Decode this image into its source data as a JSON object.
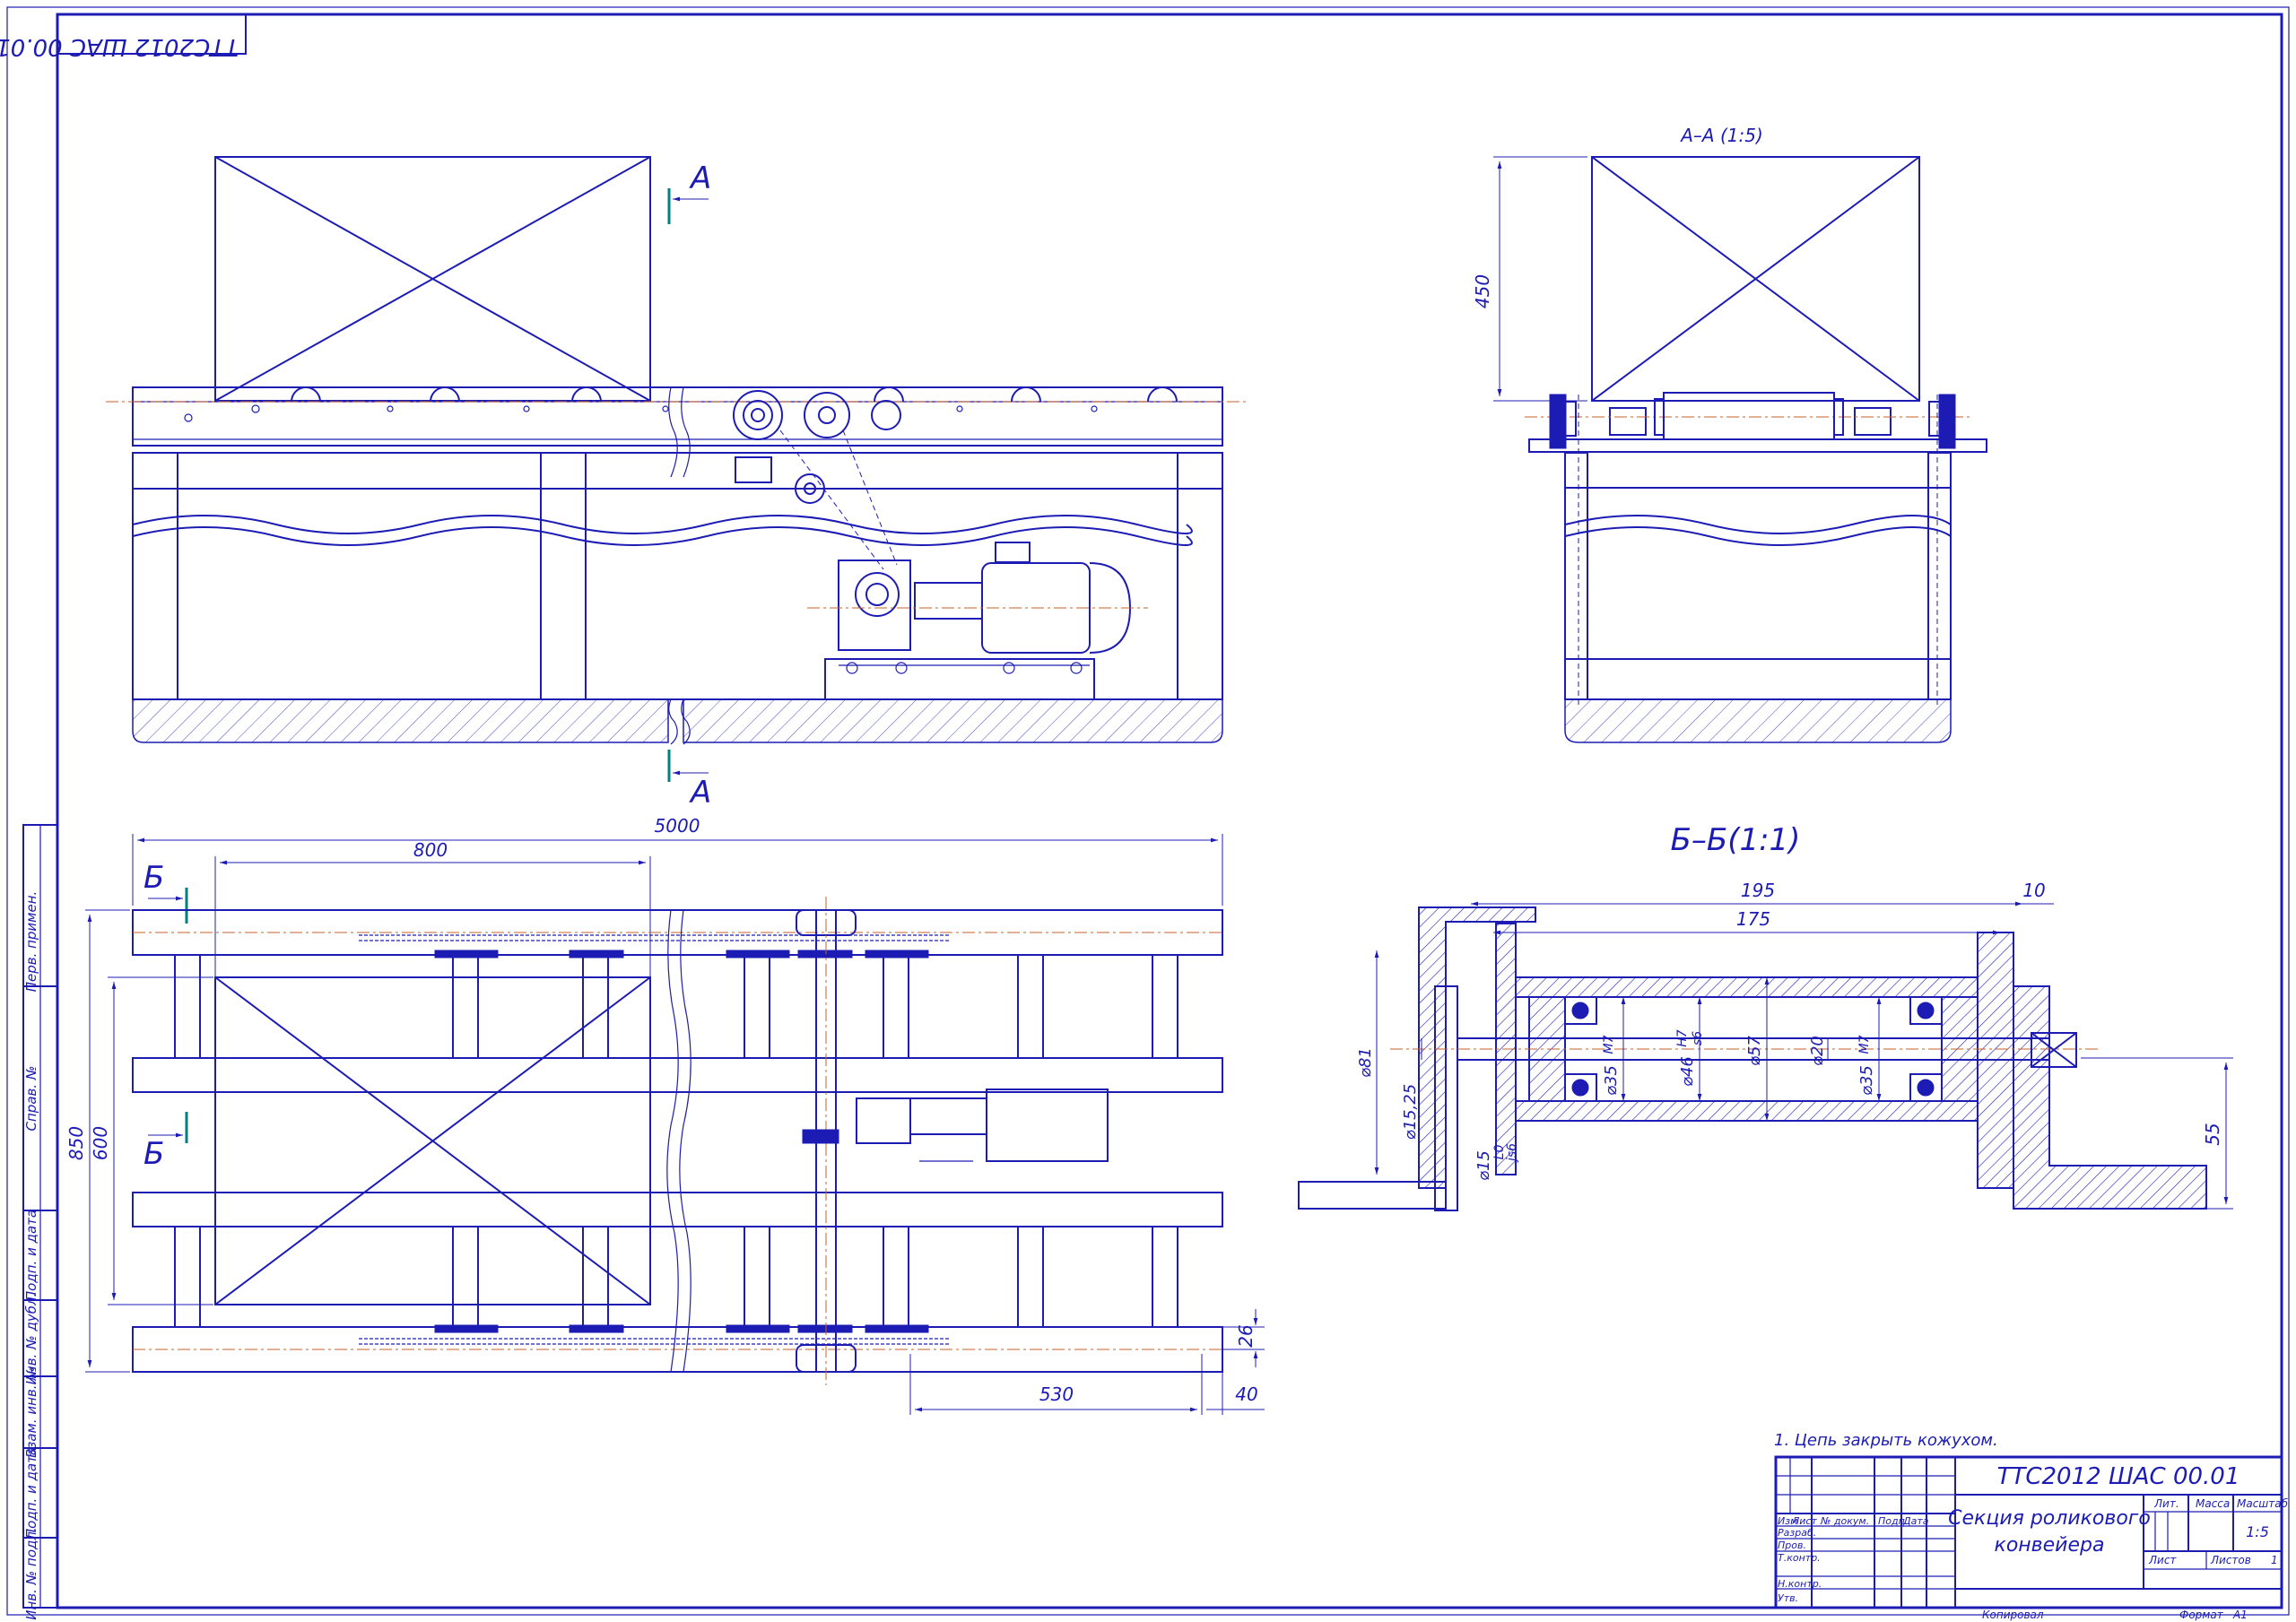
{
  "drawing": {
    "stamp_code_rotated": "ТТС2012 ШАС 00.01",
    "section_a_marker": "А",
    "section_b_marker": "Б",
    "view_a_title": "А–А (1:5)",
    "view_b_title": "Б–Б(1:1)",
    "dims": {
      "top_length": "5000",
      "box_width": "800",
      "frame_width": "850",
      "inner_width": "600",
      "pitch": "530",
      "end_offset": "40",
      "rail_height": "26",
      "box_height": "450",
      "flange_width": "195",
      "shaft_length": "175",
      "flange_thick": "10",
      "d_outer": "⌀81",
      "d_shaft": "⌀15,25",
      "d_fit": "⌀15",
      "d_bearing": "⌀35",
      "d_hub": "⌀46",
      "d_tube": "⌀57",
      "d_inner": "⌀20",
      "d_bearing2": "⌀35",
      "angle_height": "55"
    },
    "fits": {
      "m7": "М7",
      "h7": "Н7",
      "s6": "s6",
      "l0": "L0",
      "js6": "js6"
    }
  },
  "notes": {
    "note_1": "1. Цепь закрыть кожухом."
  },
  "title_block": {
    "code": "ТТС2012 ШАС 00.01",
    "name_line1": "Секция роликового",
    "name_line2": "конвейера",
    "col_izm": "Изм",
    "col_list": "Лист",
    "col_doc": "№ докум.",
    "col_sign": "Подп.",
    "col_date": "Дата",
    "row_razrab": "Разраб.",
    "row_prov": "Пров.",
    "row_tkontr": "Т.контр.",
    "row_nkontr": "Н.контр.",
    "row_utv": "Утв.",
    "lit": "Лит.",
    "massa": "Масса",
    "masshtab": "Масштаб",
    "scale_value": "1:5",
    "list_label": "Лист",
    "listov_label": "Листов",
    "listov_value": "1",
    "kopiroval": "Копировал",
    "format_label": "Формат",
    "format_value": "А1"
  },
  "side_strip": {
    "perv_primen": "Перв. примен.",
    "sprav_no": "Справ. №",
    "podp_data_1": "Подп. и дата",
    "inv_dubl": "Инв. № дубл.",
    "vzam_inv": "Взам. инв. №",
    "podp_data_2": "Подп. и дата",
    "inv_podl": "Инв. № подл."
  }
}
